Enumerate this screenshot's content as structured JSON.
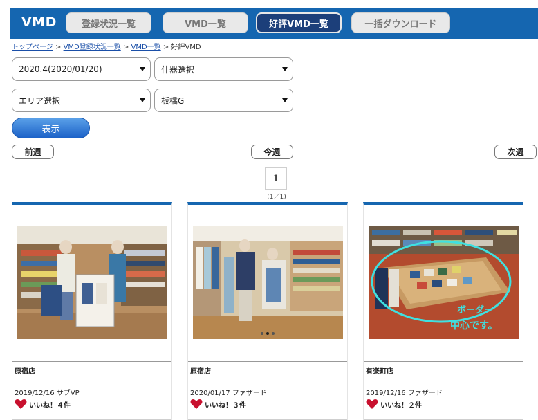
{
  "header": {
    "logo": "VMD",
    "nav": [
      {
        "label": "登録状況一覧",
        "active": false
      },
      {
        "label": "VMD一覧",
        "active": false
      },
      {
        "label": "好評VMD一覧",
        "active": true
      },
      {
        "label": "一括ダウンロード",
        "active": false
      }
    ],
    "brand_color": "#1566b0"
  },
  "breadcrumb": {
    "items": [
      "トップページ",
      "VMD登録状況一覧",
      "VMD一覧",
      "好評VMD"
    ],
    "separator": ">"
  },
  "filters": {
    "period": "2020.4(2020/01/20)",
    "fixture": "什器選択",
    "area": "エリア選択",
    "group": "板橋G"
  },
  "show_button": "表示",
  "week_nav": {
    "prev": "前週",
    "current": "今週",
    "next": "次週"
  },
  "pagination": {
    "current_page": "1",
    "info": "(1／1)"
  },
  "cards": [
    {
      "store": "原宿店",
      "date_caption": "2019/12/16 サブVP",
      "likes": "いいね！４件"
    },
    {
      "store": "原宿店",
      "date_caption": "2020/01/17 ファザード",
      "likes": "いいね！３件"
    },
    {
      "store": "有楽町店",
      "date_caption": "2019/12/16 ファザード",
      "likes": "いいね！２件",
      "photo_annotation": "ボーダー 中心です。"
    }
  ],
  "icons": {
    "heart": "heart-icon",
    "caret": "chevron-down-icon"
  }
}
